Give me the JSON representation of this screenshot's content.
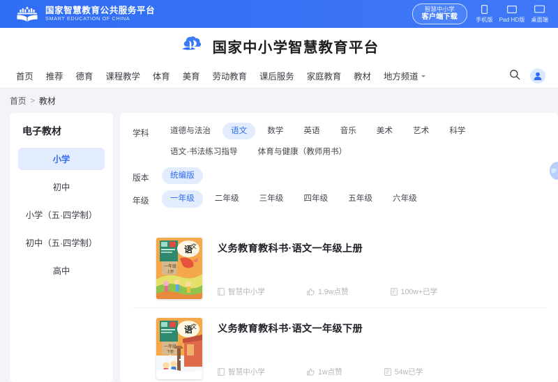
{
  "topbar": {
    "brand_cn": "国家智慧教育公共服务平台",
    "brand_en": "SMART EDUCATION OF CHINA",
    "download_line1": "智慧中小学",
    "download_line2": "客户端下载",
    "devices": [
      {
        "label": "手机版",
        "icon": "phone-icon"
      },
      {
        "label": "Pad HD版",
        "icon": "tablet-icon"
      },
      {
        "label": "桌面端",
        "icon": "desktop-icon"
      }
    ],
    "accent": "#2f6df4"
  },
  "sitehead": {
    "title": "国家中小学智慧教育平台",
    "logo": "cloud-book-logo"
  },
  "nav": {
    "items": [
      {
        "label": "首页"
      },
      {
        "label": "推荐"
      },
      {
        "label": "德育"
      },
      {
        "label": "课程教学"
      },
      {
        "label": "体育"
      },
      {
        "label": "美育"
      },
      {
        "label": "劳动教育"
      },
      {
        "label": "课后服务"
      },
      {
        "label": "家庭教育"
      },
      {
        "label": "教材"
      },
      {
        "label": "地方频道",
        "caret": true
      }
    ],
    "search_icon": "search-icon",
    "avatar_icon": "user-avatar-icon"
  },
  "breadcrumb": {
    "home": "首页",
    "separator": ">",
    "current": "教材"
  },
  "sidebar": {
    "title": "电子教材",
    "items": [
      {
        "label": "小学",
        "active": true
      },
      {
        "label": "初中",
        "active": false
      },
      {
        "label": "小学（五·四学制）",
        "active": false
      },
      {
        "label": "初中（五·四学制）",
        "active": false
      },
      {
        "label": "高中",
        "active": false
      }
    ]
  },
  "filters": [
    {
      "label": "学科",
      "options": [
        {
          "label": "道德与法治",
          "active": false
        },
        {
          "label": "语文",
          "active": true
        },
        {
          "label": "数学",
          "active": false
        },
        {
          "label": "英语",
          "active": false
        },
        {
          "label": "音乐",
          "active": false
        },
        {
          "label": "美术",
          "active": false
        },
        {
          "label": "艺术",
          "active": false
        },
        {
          "label": "科学",
          "active": false
        },
        {
          "label": "语文·书法练习指导",
          "active": false
        },
        {
          "label": "体育与健康（教师用书）",
          "active": false
        }
      ]
    },
    {
      "label": "版本",
      "options": [
        {
          "label": "统编版",
          "active": true
        }
      ]
    },
    {
      "label": "年级",
      "options": [
        {
          "label": "一年级",
          "active": true
        },
        {
          "label": "二年级",
          "active": false
        },
        {
          "label": "三年级",
          "active": false
        },
        {
          "label": "四年级",
          "active": false
        },
        {
          "label": "五年级",
          "active": false
        },
        {
          "label": "六年级",
          "active": false
        }
      ]
    }
  ],
  "books": [
    {
      "title": "义务教育教科书·语文一年级上册",
      "cover_subject": "语文",
      "cover_grade": "一年级",
      "cover_volume": "上册",
      "cover_season": "autumn",
      "publisher": "智慧中小学",
      "likes": "1.9w点赞",
      "learners": "100w+已学"
    },
    {
      "title": "义务教育教科书·语文一年级下册",
      "cover_subject": "语文",
      "cover_grade": "一年级",
      "cover_volume": "下册",
      "cover_season": "winter",
      "publisher": "智慧中小学",
      "likes": "1w点赞",
      "learners": "54w已学"
    }
  ],
  "edge_tab": {
    "icon": "feedback-tab-icon"
  }
}
